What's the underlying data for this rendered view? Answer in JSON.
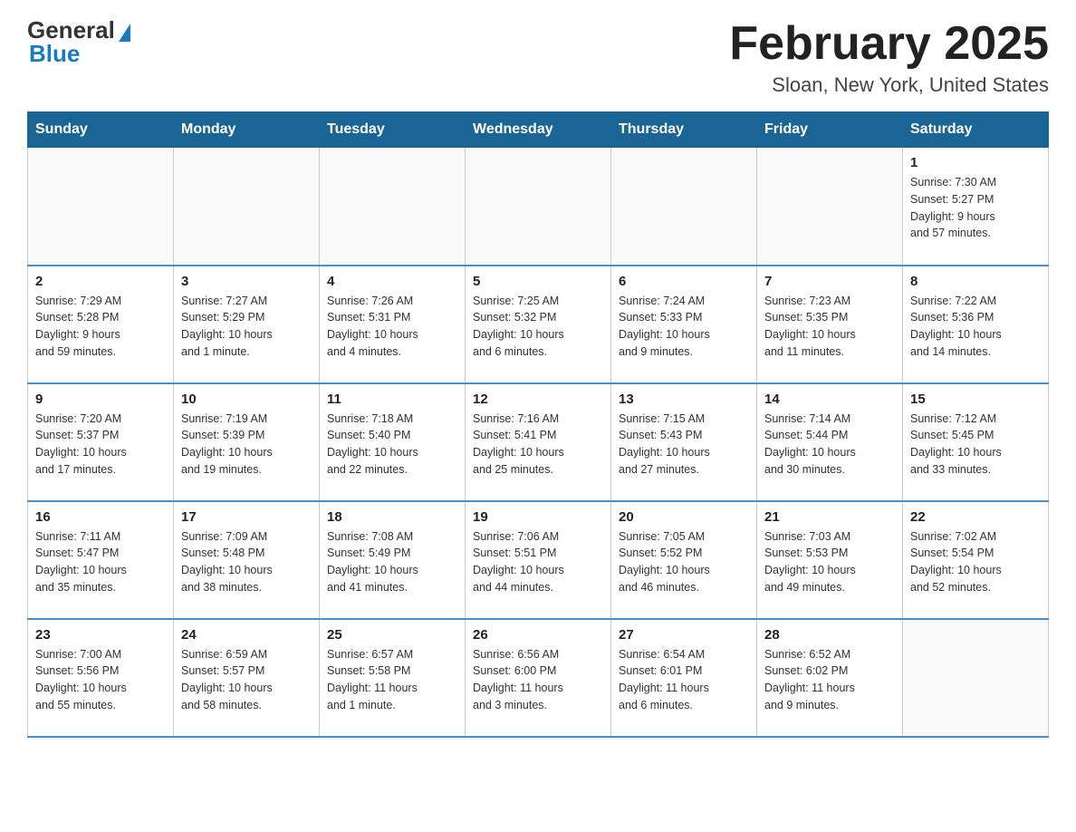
{
  "logo": {
    "general": "General",
    "blue": "Blue"
  },
  "title": "February 2025",
  "subtitle": "Sloan, New York, United States",
  "days_of_week": [
    "Sunday",
    "Monday",
    "Tuesday",
    "Wednesday",
    "Thursday",
    "Friday",
    "Saturday"
  ],
  "weeks": [
    [
      {
        "day": "",
        "info": ""
      },
      {
        "day": "",
        "info": ""
      },
      {
        "day": "",
        "info": ""
      },
      {
        "day": "",
        "info": ""
      },
      {
        "day": "",
        "info": ""
      },
      {
        "day": "",
        "info": ""
      },
      {
        "day": "1",
        "info": "Sunrise: 7:30 AM\nSunset: 5:27 PM\nDaylight: 9 hours\nand 57 minutes."
      }
    ],
    [
      {
        "day": "2",
        "info": "Sunrise: 7:29 AM\nSunset: 5:28 PM\nDaylight: 9 hours\nand 59 minutes."
      },
      {
        "day": "3",
        "info": "Sunrise: 7:27 AM\nSunset: 5:29 PM\nDaylight: 10 hours\nand 1 minute."
      },
      {
        "day": "4",
        "info": "Sunrise: 7:26 AM\nSunset: 5:31 PM\nDaylight: 10 hours\nand 4 minutes."
      },
      {
        "day": "5",
        "info": "Sunrise: 7:25 AM\nSunset: 5:32 PM\nDaylight: 10 hours\nand 6 minutes."
      },
      {
        "day": "6",
        "info": "Sunrise: 7:24 AM\nSunset: 5:33 PM\nDaylight: 10 hours\nand 9 minutes."
      },
      {
        "day": "7",
        "info": "Sunrise: 7:23 AM\nSunset: 5:35 PM\nDaylight: 10 hours\nand 11 minutes."
      },
      {
        "day": "8",
        "info": "Sunrise: 7:22 AM\nSunset: 5:36 PM\nDaylight: 10 hours\nand 14 minutes."
      }
    ],
    [
      {
        "day": "9",
        "info": "Sunrise: 7:20 AM\nSunset: 5:37 PM\nDaylight: 10 hours\nand 17 minutes."
      },
      {
        "day": "10",
        "info": "Sunrise: 7:19 AM\nSunset: 5:39 PM\nDaylight: 10 hours\nand 19 minutes."
      },
      {
        "day": "11",
        "info": "Sunrise: 7:18 AM\nSunset: 5:40 PM\nDaylight: 10 hours\nand 22 minutes."
      },
      {
        "day": "12",
        "info": "Sunrise: 7:16 AM\nSunset: 5:41 PM\nDaylight: 10 hours\nand 25 minutes."
      },
      {
        "day": "13",
        "info": "Sunrise: 7:15 AM\nSunset: 5:43 PM\nDaylight: 10 hours\nand 27 minutes."
      },
      {
        "day": "14",
        "info": "Sunrise: 7:14 AM\nSunset: 5:44 PM\nDaylight: 10 hours\nand 30 minutes."
      },
      {
        "day": "15",
        "info": "Sunrise: 7:12 AM\nSunset: 5:45 PM\nDaylight: 10 hours\nand 33 minutes."
      }
    ],
    [
      {
        "day": "16",
        "info": "Sunrise: 7:11 AM\nSunset: 5:47 PM\nDaylight: 10 hours\nand 35 minutes."
      },
      {
        "day": "17",
        "info": "Sunrise: 7:09 AM\nSunset: 5:48 PM\nDaylight: 10 hours\nand 38 minutes."
      },
      {
        "day": "18",
        "info": "Sunrise: 7:08 AM\nSunset: 5:49 PM\nDaylight: 10 hours\nand 41 minutes."
      },
      {
        "day": "19",
        "info": "Sunrise: 7:06 AM\nSunset: 5:51 PM\nDaylight: 10 hours\nand 44 minutes."
      },
      {
        "day": "20",
        "info": "Sunrise: 7:05 AM\nSunset: 5:52 PM\nDaylight: 10 hours\nand 46 minutes."
      },
      {
        "day": "21",
        "info": "Sunrise: 7:03 AM\nSunset: 5:53 PM\nDaylight: 10 hours\nand 49 minutes."
      },
      {
        "day": "22",
        "info": "Sunrise: 7:02 AM\nSunset: 5:54 PM\nDaylight: 10 hours\nand 52 minutes."
      }
    ],
    [
      {
        "day": "23",
        "info": "Sunrise: 7:00 AM\nSunset: 5:56 PM\nDaylight: 10 hours\nand 55 minutes."
      },
      {
        "day": "24",
        "info": "Sunrise: 6:59 AM\nSunset: 5:57 PM\nDaylight: 10 hours\nand 58 minutes."
      },
      {
        "day": "25",
        "info": "Sunrise: 6:57 AM\nSunset: 5:58 PM\nDaylight: 11 hours\nand 1 minute."
      },
      {
        "day": "26",
        "info": "Sunrise: 6:56 AM\nSunset: 6:00 PM\nDaylight: 11 hours\nand 3 minutes."
      },
      {
        "day": "27",
        "info": "Sunrise: 6:54 AM\nSunset: 6:01 PM\nDaylight: 11 hours\nand 6 minutes."
      },
      {
        "day": "28",
        "info": "Sunrise: 6:52 AM\nSunset: 6:02 PM\nDaylight: 11 hours\nand 9 minutes."
      },
      {
        "day": "",
        "info": ""
      }
    ]
  ]
}
